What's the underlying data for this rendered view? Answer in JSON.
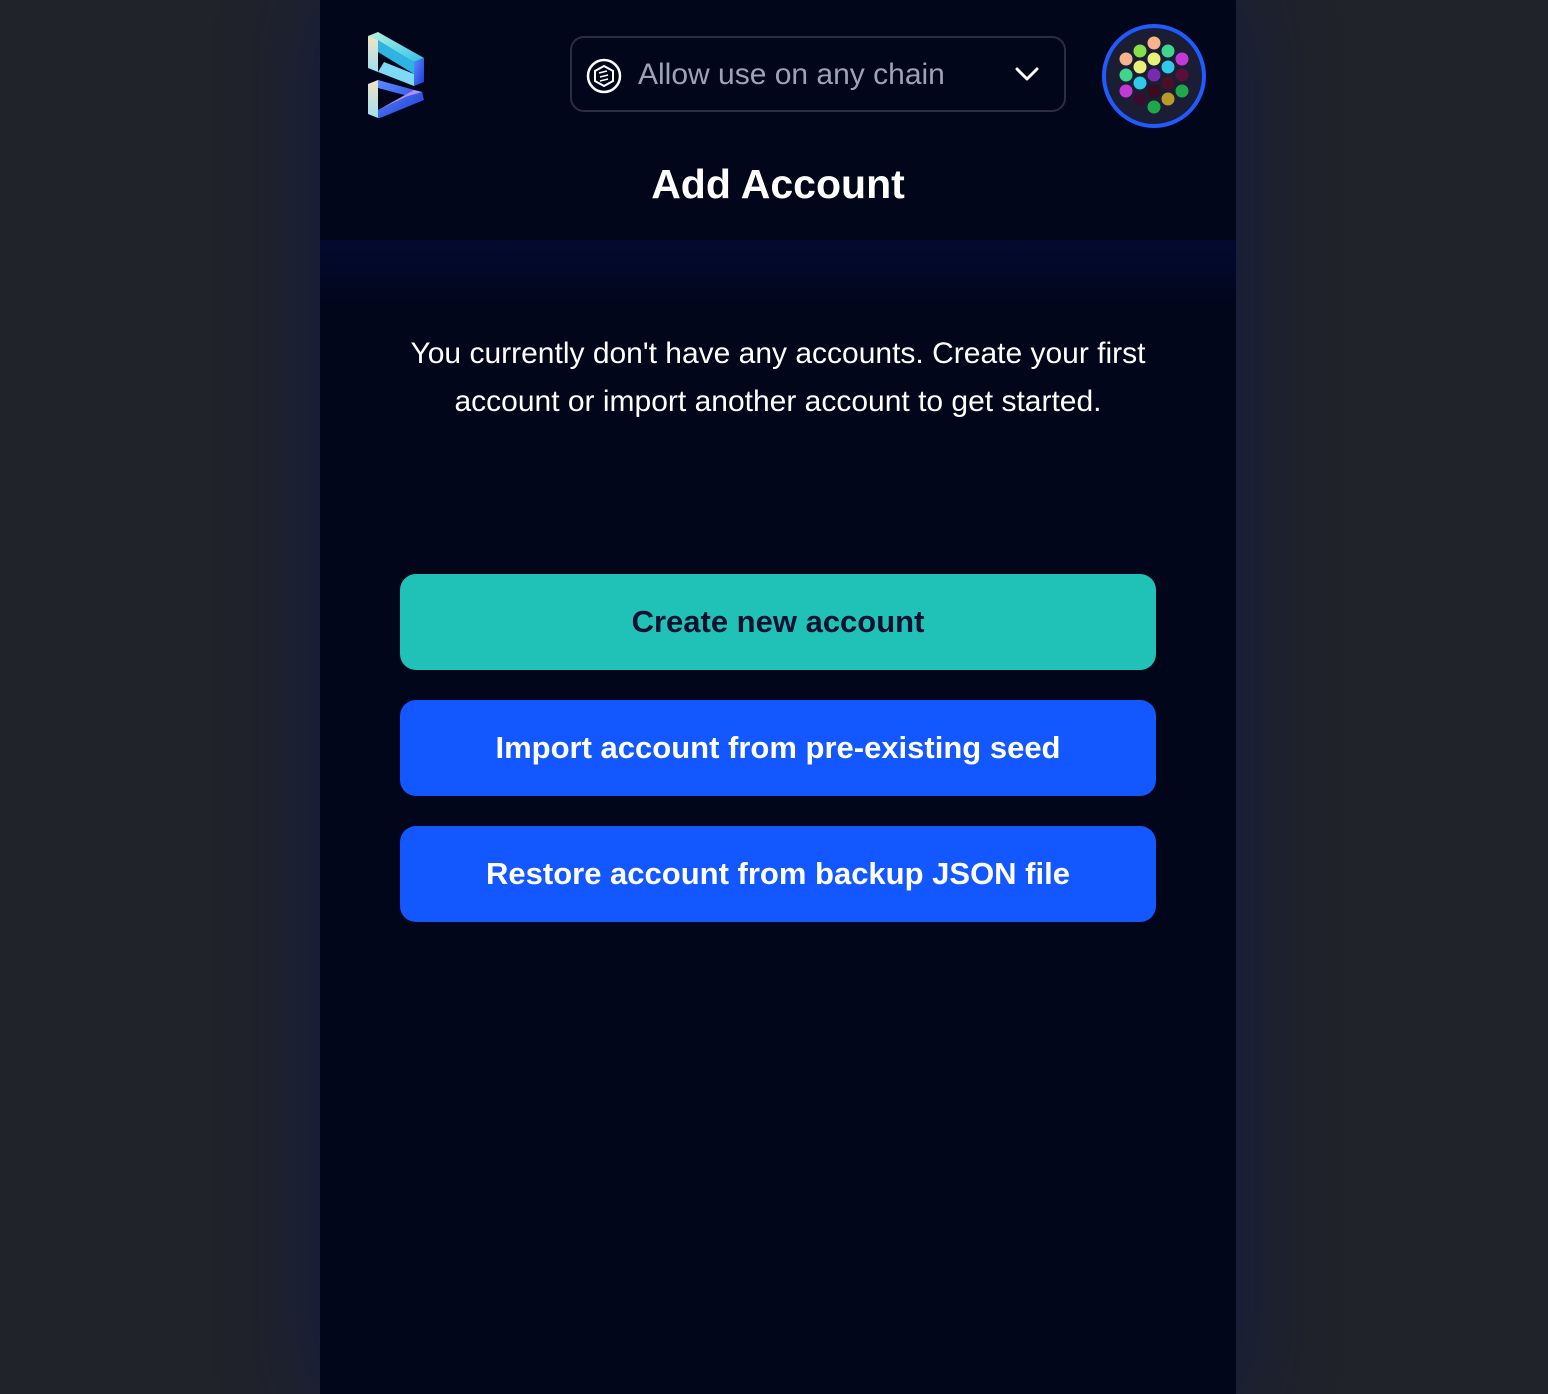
{
  "colors": {
    "background": "#20232a",
    "popup_background": "#02061a",
    "primary_teal": "#20c2b8",
    "primary_blue": "#1257ff",
    "avatar_ring": "#1f5bff"
  },
  "header": {
    "logo_icon": "app-logo-icon",
    "chain_selector": {
      "icon": "chain-network-icon",
      "label": "Allow use on any chain",
      "chevron_icon": "chevron-down-icon"
    },
    "avatar_icon": "identicon-avatar"
  },
  "main": {
    "title": "Add Account",
    "intro": "You currently don't have any accounts. Create your first account or import another account to get started.",
    "buttons": {
      "create": "Create new account",
      "import": "Import account from pre-existing seed",
      "restore": "Restore account from backup JSON file"
    }
  }
}
